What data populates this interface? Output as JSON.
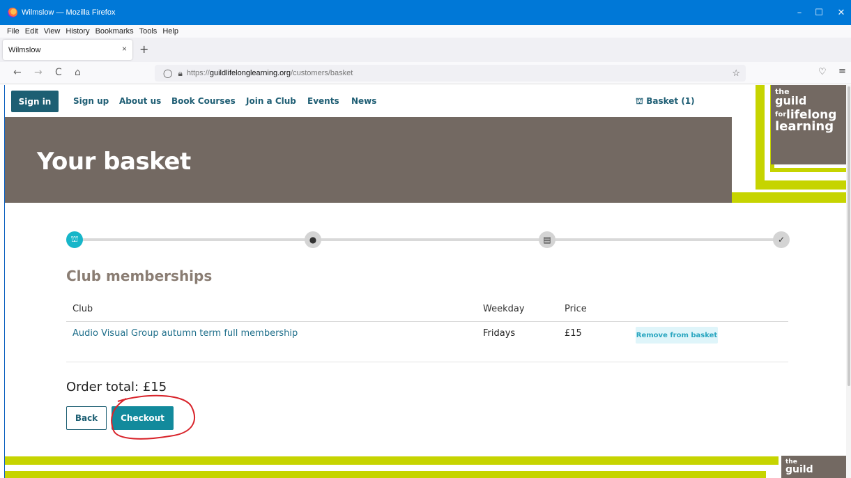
{
  "window": {
    "title": "Wilmslow — Mozilla Firefox",
    "controls": [
      "–",
      "☐",
      "✕"
    ]
  },
  "menubar": {
    "items": [
      "File",
      "Edit",
      "View",
      "History",
      "Bookmarks",
      "Tools",
      "Help"
    ]
  },
  "tab": {
    "label": "Wilmslow",
    "close": "×",
    "new_tab": "+"
  },
  "toolbar": {
    "back": "←",
    "forward": "→",
    "reload": "C",
    "home": "⌂",
    "url_prefix": "https://",
    "url_host": "guildlifelonglearning.org",
    "url_path": "/customers/basket"
  },
  "site_nav": {
    "sign_in": "Sign in",
    "links": [
      "Sign up",
      "About us",
      "Book Courses",
      "Join a Club",
      "Events",
      "News"
    ],
    "basket": "Basket (1)"
  },
  "logo": {
    "the": "the",
    "guild": "guild",
    "for": "for",
    "lifelong": "lifelong",
    "learning": "learning"
  },
  "hero": {
    "title": "Your basket"
  },
  "section": {
    "title": "Club memberships"
  },
  "table": {
    "headers": [
      "Club",
      "Weekday",
      "Price"
    ],
    "rows": [
      {
        "club": "Audio Visual Group autumn term full membership",
        "weekday": "Fridays",
        "price": "£15",
        "action": "Remove from basket"
      }
    ]
  },
  "order": {
    "total": "Order total: £15"
  },
  "buttons": {
    "back": "Back",
    "checkout": "Checkout"
  },
  "colors": {
    "brand_taupe": "#736962",
    "brand_lime": "#c6d400",
    "brand_teal": "#128a9c",
    "annotation_red": "#d8232a"
  }
}
